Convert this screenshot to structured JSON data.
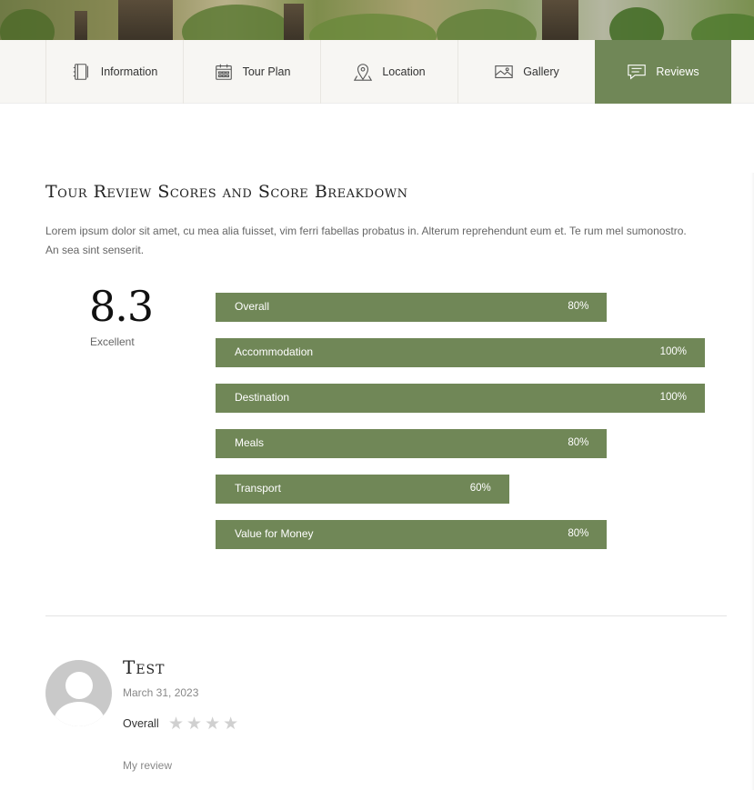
{
  "tabs": [
    {
      "label": "Information",
      "icon": "notebook-icon",
      "active": false
    },
    {
      "label": "Tour Plan",
      "icon": "calendar-icon",
      "active": false
    },
    {
      "label": "Location",
      "icon": "map-pin-icon",
      "active": false
    },
    {
      "label": "Gallery",
      "icon": "image-icon",
      "active": false
    },
    {
      "label": "Reviews",
      "icon": "comment-icon",
      "active": true
    }
  ],
  "reviews_section": {
    "title": "Tour Review Scores and Score Breakdown",
    "intro": "Lorem ipsum dolor sit amet, cu mea alia fuisset, vim ferri fabellas probatus in. Alterum reprehendunt eum et. Te rum mel sumonostro. An sea sint senserit.",
    "score": "8.3",
    "score_label": "Excellent",
    "breakdown": [
      {
        "label": "Overall",
        "percent": "80%",
        "value": 80
      },
      {
        "label": "Accommodation",
        "percent": "100%",
        "value": 100
      },
      {
        "label": "Destination",
        "percent": "100%",
        "value": 100
      },
      {
        "label": "Meals",
        "percent": "80%",
        "value": 80
      },
      {
        "label": "Transport",
        "percent": "60%",
        "value": 60
      },
      {
        "label": "Value for Money",
        "percent": "80%",
        "value": 80
      }
    ]
  },
  "review": {
    "name": "Test",
    "date": "March 31, 2023",
    "overall_label": "Overall",
    "stars_filled": 0,
    "stars_total": 4,
    "text": "My review"
  },
  "colors": {
    "accent": "#708757",
    "star_empty": "#d0d0d0"
  }
}
